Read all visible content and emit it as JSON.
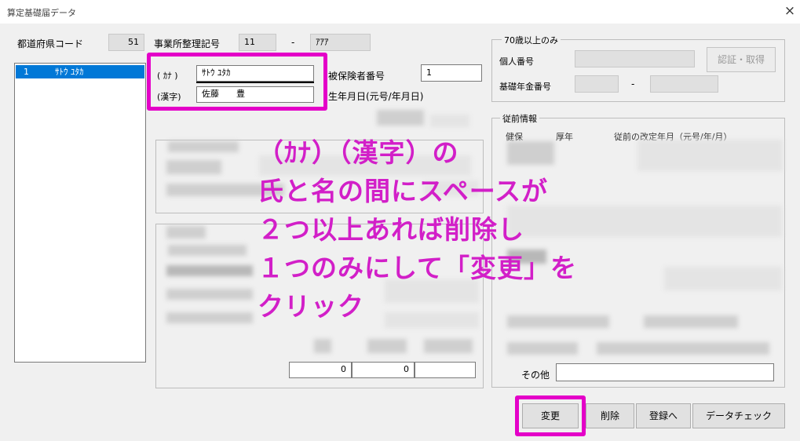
{
  "window": {
    "title": "算定基礎届データ",
    "close_icon": "×"
  },
  "header": {
    "pref_code_label": "都道府県コード",
    "pref_code_value": "51",
    "office_code_label": "事業所整理記号",
    "office_code_value1": "11",
    "office_code_sep": "-",
    "office_code_value2": "ｱｱｱ"
  },
  "employee_list": {
    "items": [
      {
        "no": "1",
        "name": "ｻﾄｳ ﾕﾀｶ",
        "selected": true
      }
    ]
  },
  "name_fields": {
    "kana_label": "( ｶﾅ )",
    "kana_value": "ｻﾄｳ  ﾕﾀｶ",
    "kanji_label": "(漢字)",
    "kanji_value": "佐藤　　豊"
  },
  "insured": {
    "number_label": "被保険者番号",
    "number_value": "1",
    "birth_label": "生年月日(元号/年月日)"
  },
  "over70": {
    "group_label": "70歳以上のみ",
    "mynumber_label": "個人番号",
    "auth_button": "認証・取得",
    "pension_label": "基礎年金番号",
    "pension_sep": "-"
  },
  "previous": {
    "group_label": "従前情報",
    "col1": "健保",
    "col2": "厚年",
    "col3": "従前の改定年月（元号/年/月）"
  },
  "totals": {
    "value1": "0",
    "value2": "0"
  },
  "other": {
    "label": "その他"
  },
  "buttons": {
    "change": "変更",
    "delete": "削除",
    "register": "登録へ",
    "check": "データチェック"
  },
  "annotation": {
    "lines": [
      "（ｶﾅ）（漢字）の",
      "氏と名の間にスペースが",
      "２つ以上あれば削除し",
      "１つのみにして「変更」を",
      "クリック"
    ],
    "color": "#d21fc8"
  }
}
